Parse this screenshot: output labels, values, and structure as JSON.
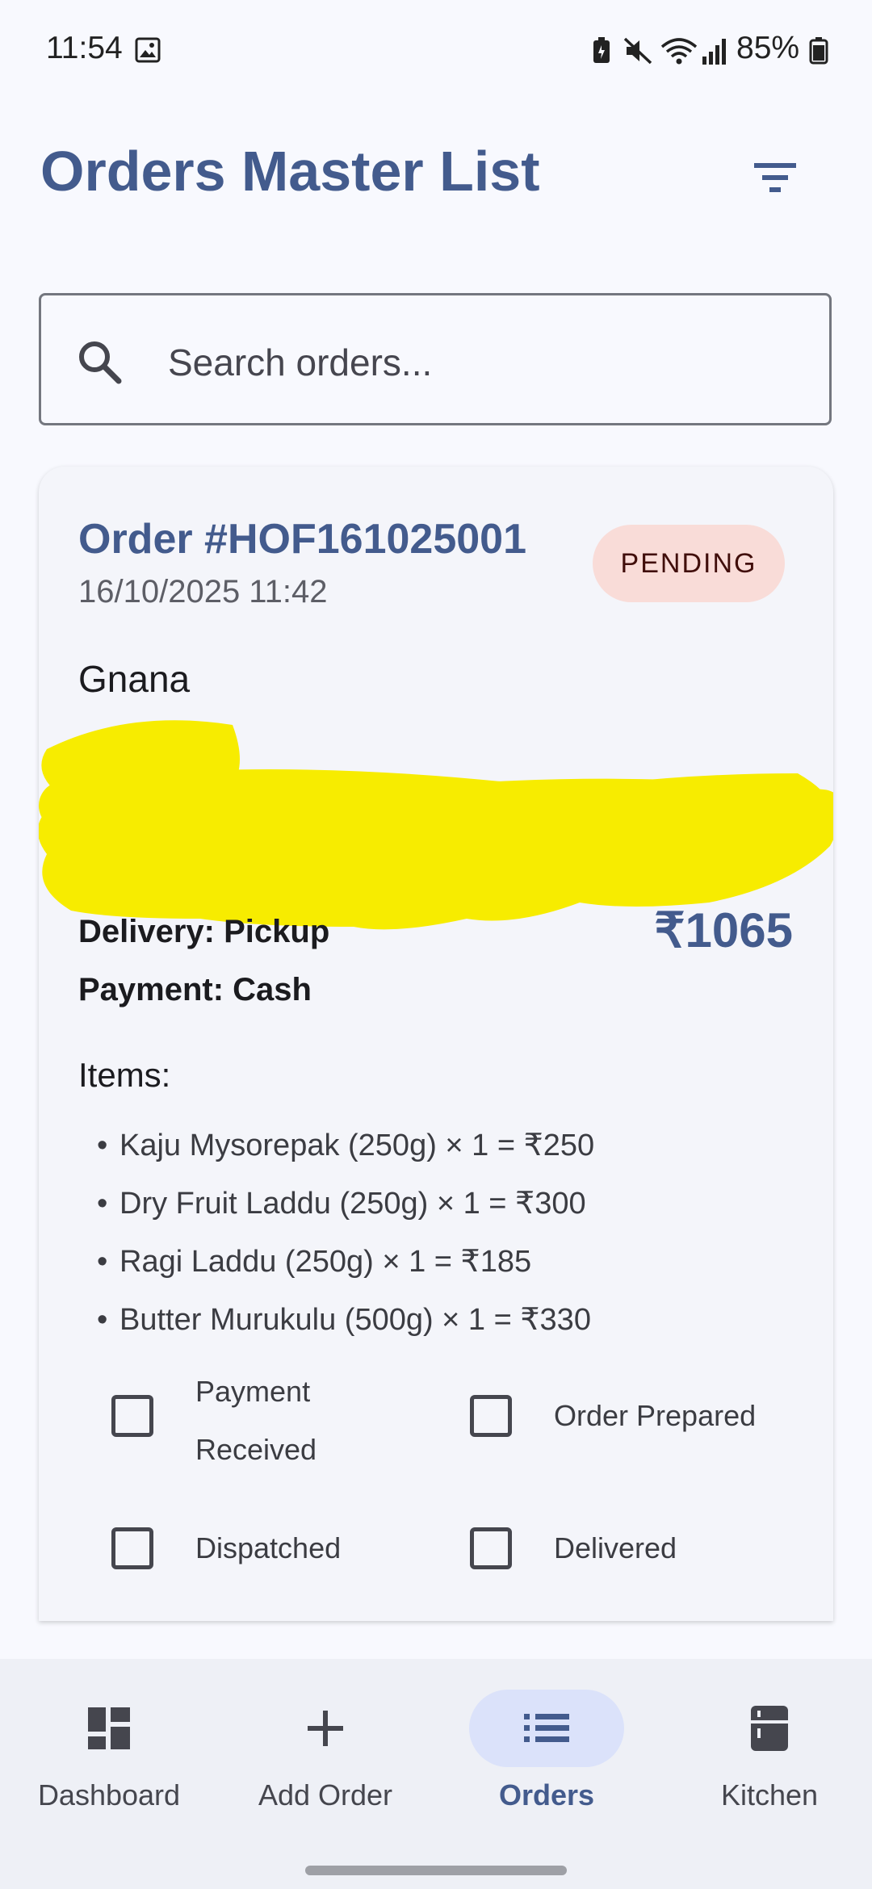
{
  "status_bar": {
    "time": "11:54",
    "battery": "85%"
  },
  "header": {
    "title": "Orders Master List"
  },
  "search": {
    "placeholder": "Search orders..."
  },
  "order": {
    "id": "Order #HOF161025001",
    "datetime": "16/10/2025 11:42",
    "status": "PENDING",
    "customer": "Gnana",
    "delivery": "Delivery: Pickup",
    "payment": "Payment: Cash",
    "total": "₹1065",
    "items_title": "Items:",
    "items": [
      "Kaju Mysorepak (250g) × 1 = ₹250",
      "Dry Fruit Laddu (250g) × 1 = ₹300",
      "Ragi Laddu (250g) × 1 = ₹185",
      "Butter Murukulu (500g) × 1 = ₹330"
    ],
    "checklist": [
      {
        "label_line1": "Payment",
        "label_line2": "Received",
        "checked": false
      },
      {
        "label": "Order Prepared",
        "checked": false
      },
      {
        "label": "Dispatched",
        "checked": false
      },
      {
        "label": "Delivered",
        "checked": false
      }
    ]
  },
  "bottom_nav": {
    "items": [
      {
        "label": "Dashboard",
        "icon": "dashboard-icon",
        "active": false
      },
      {
        "label": "Add Order",
        "icon": "plus-icon",
        "active": false
      },
      {
        "label": "Orders",
        "icon": "list-icon",
        "active": true
      },
      {
        "label": "Kitchen",
        "icon": "kitchen-icon",
        "active": false
      }
    ]
  },
  "colors": {
    "primary": "#435b8d",
    "badge_bg": "#f9dcd8",
    "nav_active_bg": "#dbe2fa",
    "redaction": "#f7ec00"
  }
}
